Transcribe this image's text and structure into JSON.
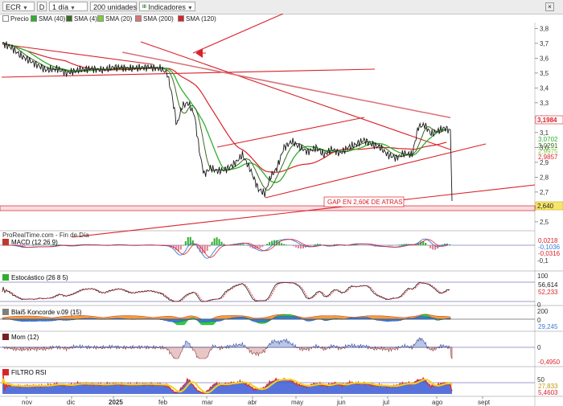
{
  "toolbar": {
    "ticker": "ECR",
    "d_label": "D",
    "period": "1 día",
    "units": "200 unidades",
    "indicators_label": "Indicadores",
    "price_label": "Precio",
    "sma": [
      {
        "label": "SMA (40)",
        "color": "#2fae2f"
      },
      {
        "label": "SMA (4)",
        "color": "#3a6b1f"
      },
      {
        "label": "SMA (20)",
        "color": "#7fcc3a"
      },
      {
        "label": "SMA (200)",
        "color": "#d9737a"
      },
      {
        "label": "SMA (120)",
        "color": "#d9222a"
      }
    ]
  },
  "colors": {
    "price": "#1a1a1a",
    "trend": "#d9222a",
    "macd": "#3a7bd5",
    "signal": "#d9222a"
  },
  "chart_data": [
    {
      "type": "line",
      "name": "price",
      "months": [
        "nov",
        "dic",
        "2025",
        "feb",
        "mar",
        "abr",
        "may",
        "jun",
        "jul",
        "ago",
        "sept"
      ],
      "y_ticks": [
        3.8,
        3.7,
        3.6,
        3.5,
        3.4,
        3.3,
        3.2,
        3.1,
        3.0,
        2.9,
        2.8,
        2.7,
        2.6,
        2.5
      ],
      "ylim": [
        2.44,
        3.84
      ],
      "price_approx": [
        [
          0,
          3.7
        ],
        [
          12,
          3.67
        ],
        [
          22,
          3.62
        ],
        [
          35,
          3.58
        ],
        [
          45,
          3.55
        ],
        [
          55,
          3.52
        ],
        [
          68,
          3.53
        ],
        [
          80,
          3.5
        ],
        [
          95,
          3.52
        ],
        [
          110,
          3.53
        ],
        [
          125,
          3.52
        ],
        [
          140,
          3.54
        ],
        [
          160,
          3.53
        ],
        [
          180,
          3.54
        ],
        [
          198,
          3.53
        ],
        [
          206,
          3.5
        ],
        [
          212,
          3.35
        ],
        [
          218,
          3.15
        ],
        [
          225,
          3.28
        ],
        [
          232,
          3.3
        ],
        [
          240,
          3.22
        ],
        [
          247,
          2.95
        ],
        [
          252,
          2.82
        ],
        [
          260,
          2.86
        ],
        [
          270,
          2.84
        ],
        [
          282,
          2.86
        ],
        [
          292,
          2.9
        ],
        [
          300,
          2.95
        ],
        [
          310,
          2.85
        ],
        [
          320,
          2.72
        ],
        [
          328,
          2.69
        ],
        [
          335,
          2.8
        ],
        [
          343,
          2.86
        ],
        [
          352,
          3.0
        ],
        [
          362,
          3.04
        ],
        [
          372,
          3.0
        ],
        [
          382,
          2.97
        ],
        [
          392,
          3.0
        ],
        [
          402,
          2.95
        ],
        [
          412,
          2.99
        ],
        [
          422,
          2.96
        ],
        [
          432,
          3.0
        ],
        [
          442,
          3.02
        ],
        [
          452,
          3.05
        ],
        [
          462,
          3.02
        ],
        [
          472,
          3.0
        ],
        [
          482,
          2.95
        ],
        [
          492,
          2.93
        ],
        [
          502,
          2.96
        ],
        [
          512,
          2.95
        ],
        [
          520,
          3.14
        ],
        [
          528,
          3.15
        ],
        [
          536,
          3.09
        ],
        [
          544,
          3.11
        ],
        [
          552,
          3.13
        ],
        [
          560,
          3.12
        ],
        [
          562,
          2.64
        ]
      ],
      "sma_values_right": [
        {
          "label": "3,0702",
          "color": "#2fae2f"
        },
        {
          "label": "3,0291",
          "color": "#3a6b1f"
        },
        {
          "label": "2,9975",
          "color": "#7fcc3a"
        },
        {
          "label": "2,9857",
          "color": "#d9222a"
        }
      ],
      "current_price_label": "3,1984",
      "last_price_label": "2,640",
      "annotation": "GAP EN 2,60€ DE ATRAS",
      "footer_label": "ProRealTime.com - Fin de Día"
    },
    {
      "type": "bar",
      "name": "MACD",
      "title": "MACD (12 26 9)",
      "y_ticks_labels": [
        "-0,1"
      ],
      "right_values": [
        "0,0218",
        "-0,1036",
        "-0,0316"
      ]
    },
    {
      "type": "line",
      "name": "Estocástico",
      "title": "Estocástico (26 8 5)",
      "y_ticks_labels": [
        "100",
        "0"
      ],
      "right_values": [
        "56,614",
        "52,233"
      ]
    },
    {
      "type": "area",
      "name": "Blai5 Koncorde",
      "title": "Blai5 Koncorde v.09 (15)",
      "y_ticks_labels": [
        "200",
        "0"
      ],
      "right_values": [
        "29,245"
      ]
    },
    {
      "type": "area",
      "name": "Mom",
      "title": "Mom (12)",
      "y_ticks_labels": [
        "0"
      ],
      "right_values": [
        "-0,4950"
      ]
    },
    {
      "type": "line",
      "name": "FILTRO RSI",
      "title": "FILTRO RSI",
      "y_ticks_labels": [
        "50"
      ],
      "right_values": [
        "27,833",
        "5,4603"
      ]
    }
  ]
}
